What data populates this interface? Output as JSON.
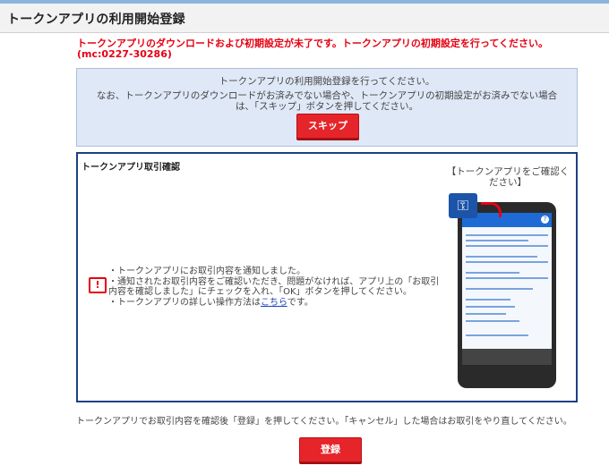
{
  "header": {
    "title": "トークンアプリの利用開始登録"
  },
  "error": {
    "message": "トークンアプリのダウンロードおよび初期設定が未了です。トークンアプリの初期設定を行ってください。(mc:0227-30286)"
  },
  "info": {
    "line1": "トークンアプリの利用開始登録を行ってください。",
    "line2": "なお、トークンアプリのダウンロードがお済みでない場合や、トークンアプリの初期設定がお済みでない場合は、「スキップ」ボタンを押してください。",
    "skip_label": "スキップ"
  },
  "confirm": {
    "title": "トークンアプリ取引確認",
    "phone_caption": "【トークンアプリをご確認ください】",
    "bullet1": "・トークンアプリにお取引内容を通知しました。",
    "bullet2": "・通知されたお取引内容をご確認いただき、問題がなければ、アプリ上の「お取引内容を確認しました」にチェックを入れ、「OK」ボタンを押してください。",
    "bullet3_prefix": "・トークンアプリの詳しい操作方法は",
    "bullet3_link": "こちら",
    "bullet3_suffix": "です。"
  },
  "footer": {
    "text": "トークンアプリでお取引内容を確認後「登録」を押してください。「キャンセル」した場合はお取引をやり直してください。",
    "register_label": "登録"
  },
  "icons": {
    "alert": "alert-icon",
    "shield": "shield-key-icon"
  },
  "colors": {
    "accent_red": "#e60012",
    "primary_blue": "#1c3f86"
  }
}
